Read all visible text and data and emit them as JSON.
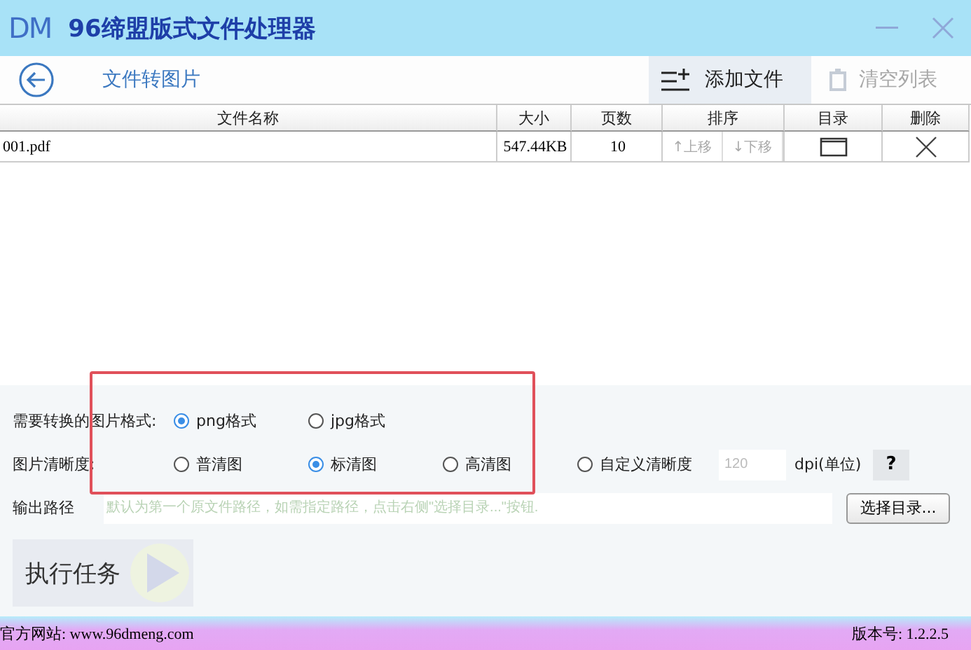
{
  "window": {
    "logo": "DM",
    "title": "96缔盟版式文件处理器"
  },
  "toolbar": {
    "page_title": "文件转图片",
    "add_button": "添加文件",
    "clear_button": {
      "label": "清空列表",
      "disabled": true
    }
  },
  "table": {
    "columns": [
      "文件名称",
      "大小",
      "页数",
      "排序",
      "目录",
      "删除"
    ],
    "rows": [
      {
        "name": "001.pdf",
        "size": "547.44KB",
        "pages": "10",
        "move_up": "↑上移",
        "move_down": "↓下移"
      }
    ]
  },
  "format": {
    "label": "需要转换的图片格式:",
    "options": [
      {
        "label": "png格式",
        "selected": true
      },
      {
        "label": "jpg格式",
        "selected": false
      }
    ]
  },
  "quality": {
    "label": "图片清晰度:",
    "options": [
      {
        "label": "普清图",
        "selected": false
      },
      {
        "label": "标清图",
        "selected": true
      },
      {
        "label": "高清图",
        "selected": false
      },
      {
        "label": "自定义清晰度",
        "selected": false
      }
    ],
    "dpi_placeholder": "120",
    "dpi_unit": "dpi(单位)",
    "help_button": "?"
  },
  "output": {
    "label": "输出路径",
    "placeholder": "默认为第一个原文件路径，如需指定路径，点击右侧\"选择目录...\"按钮.",
    "browse_button": "选择目录..."
  },
  "run_button": "执行任务",
  "status_bar": {
    "website": "官方网站:  www.96dmeng.com",
    "version": "版本号: 1.2.2.5"
  }
}
